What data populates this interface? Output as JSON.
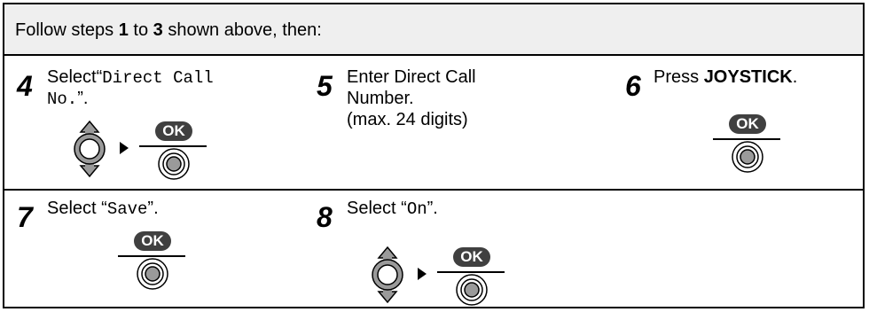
{
  "header": {
    "prefix": "Follow steps ",
    "from": "1",
    "mid": " to ",
    "to": "3",
    "suffix": " shown above, then:"
  },
  "steps": [
    {
      "number": "4",
      "prefix": "Select",
      "quote_open": "“",
      "value_line1": "Direct Call",
      "value_line2": "No.",
      "quote_close": "”.",
      "ok_label": "OK"
    },
    {
      "number": "5",
      "line1": "Enter Direct Call",
      "line2": "Number.",
      "line3": "(max. 24 digits)"
    },
    {
      "number": "6",
      "prefix": "Press ",
      "key": "JOYSTICK",
      "suffix": ".",
      "ok_label": "OK"
    },
    {
      "number": "7",
      "prefix": "Select “",
      "value": "Save",
      "suffix": "”.",
      "ok_label": "OK"
    },
    {
      "number": "8",
      "prefix": "Select “",
      "value": "On",
      "suffix": "”.",
      "ok_label": "OK"
    }
  ],
  "icons": {
    "joystick_scroll": "up-down-joystick-icon",
    "arrow": "right-arrow-icon",
    "ok_button": "ok-joystick-press-icon"
  },
  "colors": {
    "ok_fill": "#404040",
    "icon_gray": "#9a9a9a",
    "header_bg": "#efefef"
  }
}
